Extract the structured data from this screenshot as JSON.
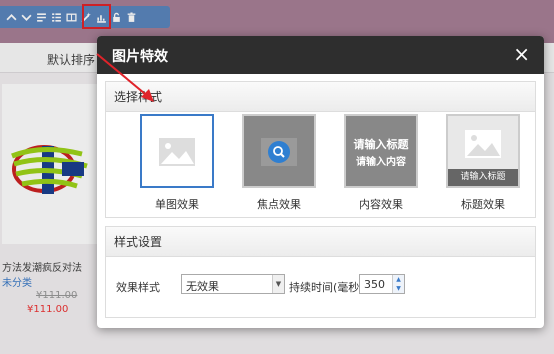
{
  "toolbar": {
    "icons": [
      "chevron-up",
      "chevron-down",
      "edit-text",
      "list",
      "image-frame",
      "magic-wand",
      "chart",
      "lock",
      "trash"
    ]
  },
  "sort_bar": {
    "default_label": "默认排序"
  },
  "product": {
    "title": "方法发潮疯反对法",
    "category": "未分类",
    "old_price": "¥111.00",
    "new_price": "¥111.00"
  },
  "dialog": {
    "title": "图片特效",
    "close": "×",
    "section_style": {
      "header": "选择样式",
      "items": [
        {
          "label": "单图效果",
          "selected": true
        },
        {
          "label": "焦点效果",
          "selected": false
        },
        {
          "label": "内容效果",
          "thumb_title": "请输入标题",
          "thumb_content": "请输入内容",
          "selected": false
        },
        {
          "label": "标题效果",
          "thumb_caption": "请输入标题",
          "selected": false
        }
      ]
    },
    "section_settings": {
      "header": "样式设置",
      "effect_label": "效果样式",
      "effect_value": "无效果",
      "duration_label": "持续时间(毫秒)",
      "duration_value": "350"
    }
  },
  "colors": {
    "accent": "#3a7ac8",
    "highlight": "#e0232a",
    "dialog_header": "#2e2e2e"
  }
}
